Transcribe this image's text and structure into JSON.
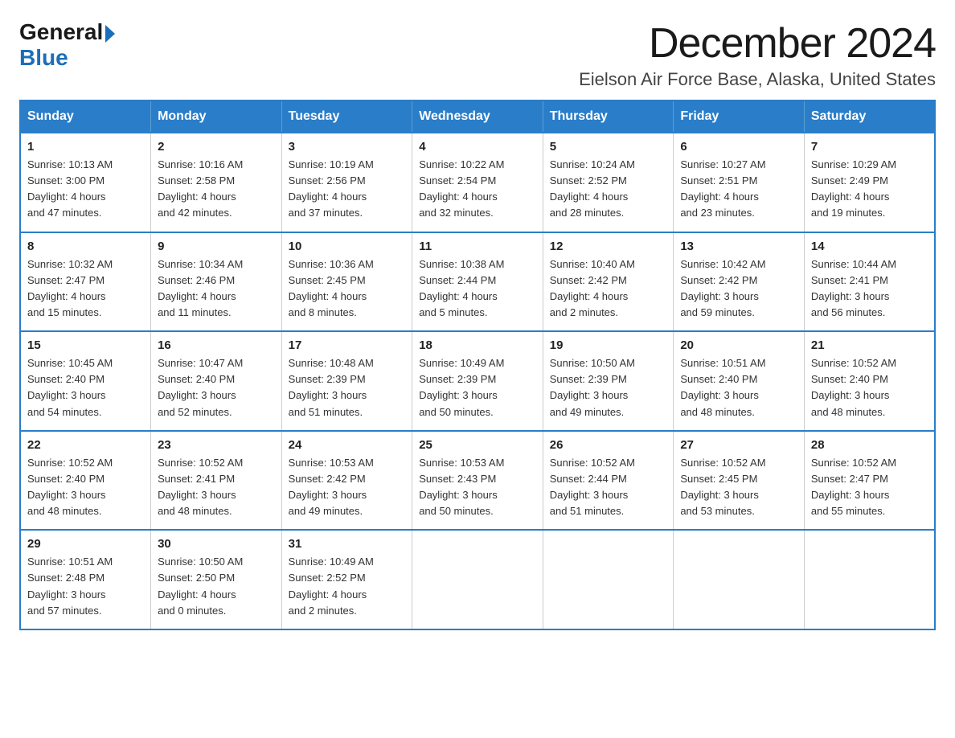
{
  "logo": {
    "general": "General",
    "triangle": "▶",
    "blue": "Blue"
  },
  "title": "December 2024",
  "subtitle": "Eielson Air Force Base, Alaska, United States",
  "days_of_week": [
    "Sunday",
    "Monday",
    "Tuesday",
    "Wednesday",
    "Thursday",
    "Friday",
    "Saturday"
  ],
  "weeks": [
    [
      {
        "day": "1",
        "info": "Sunrise: 10:13 AM\nSunset: 3:00 PM\nDaylight: 4 hours\nand 47 minutes."
      },
      {
        "day": "2",
        "info": "Sunrise: 10:16 AM\nSunset: 2:58 PM\nDaylight: 4 hours\nand 42 minutes."
      },
      {
        "day": "3",
        "info": "Sunrise: 10:19 AM\nSunset: 2:56 PM\nDaylight: 4 hours\nand 37 minutes."
      },
      {
        "day": "4",
        "info": "Sunrise: 10:22 AM\nSunset: 2:54 PM\nDaylight: 4 hours\nand 32 minutes."
      },
      {
        "day": "5",
        "info": "Sunrise: 10:24 AM\nSunset: 2:52 PM\nDaylight: 4 hours\nand 28 minutes."
      },
      {
        "day": "6",
        "info": "Sunrise: 10:27 AM\nSunset: 2:51 PM\nDaylight: 4 hours\nand 23 minutes."
      },
      {
        "day": "7",
        "info": "Sunrise: 10:29 AM\nSunset: 2:49 PM\nDaylight: 4 hours\nand 19 minutes."
      }
    ],
    [
      {
        "day": "8",
        "info": "Sunrise: 10:32 AM\nSunset: 2:47 PM\nDaylight: 4 hours\nand 15 minutes."
      },
      {
        "day": "9",
        "info": "Sunrise: 10:34 AM\nSunset: 2:46 PM\nDaylight: 4 hours\nand 11 minutes."
      },
      {
        "day": "10",
        "info": "Sunrise: 10:36 AM\nSunset: 2:45 PM\nDaylight: 4 hours\nand 8 minutes."
      },
      {
        "day": "11",
        "info": "Sunrise: 10:38 AM\nSunset: 2:44 PM\nDaylight: 4 hours\nand 5 minutes."
      },
      {
        "day": "12",
        "info": "Sunrise: 10:40 AM\nSunset: 2:42 PM\nDaylight: 4 hours\nand 2 minutes."
      },
      {
        "day": "13",
        "info": "Sunrise: 10:42 AM\nSunset: 2:42 PM\nDaylight: 3 hours\nand 59 minutes."
      },
      {
        "day": "14",
        "info": "Sunrise: 10:44 AM\nSunset: 2:41 PM\nDaylight: 3 hours\nand 56 minutes."
      }
    ],
    [
      {
        "day": "15",
        "info": "Sunrise: 10:45 AM\nSunset: 2:40 PM\nDaylight: 3 hours\nand 54 minutes."
      },
      {
        "day": "16",
        "info": "Sunrise: 10:47 AM\nSunset: 2:40 PM\nDaylight: 3 hours\nand 52 minutes."
      },
      {
        "day": "17",
        "info": "Sunrise: 10:48 AM\nSunset: 2:39 PM\nDaylight: 3 hours\nand 51 minutes."
      },
      {
        "day": "18",
        "info": "Sunrise: 10:49 AM\nSunset: 2:39 PM\nDaylight: 3 hours\nand 50 minutes."
      },
      {
        "day": "19",
        "info": "Sunrise: 10:50 AM\nSunset: 2:39 PM\nDaylight: 3 hours\nand 49 minutes."
      },
      {
        "day": "20",
        "info": "Sunrise: 10:51 AM\nSunset: 2:40 PM\nDaylight: 3 hours\nand 48 minutes."
      },
      {
        "day": "21",
        "info": "Sunrise: 10:52 AM\nSunset: 2:40 PM\nDaylight: 3 hours\nand 48 minutes."
      }
    ],
    [
      {
        "day": "22",
        "info": "Sunrise: 10:52 AM\nSunset: 2:40 PM\nDaylight: 3 hours\nand 48 minutes."
      },
      {
        "day": "23",
        "info": "Sunrise: 10:52 AM\nSunset: 2:41 PM\nDaylight: 3 hours\nand 48 minutes."
      },
      {
        "day": "24",
        "info": "Sunrise: 10:53 AM\nSunset: 2:42 PM\nDaylight: 3 hours\nand 49 minutes."
      },
      {
        "day": "25",
        "info": "Sunrise: 10:53 AM\nSunset: 2:43 PM\nDaylight: 3 hours\nand 50 minutes."
      },
      {
        "day": "26",
        "info": "Sunrise: 10:52 AM\nSunset: 2:44 PM\nDaylight: 3 hours\nand 51 minutes."
      },
      {
        "day": "27",
        "info": "Sunrise: 10:52 AM\nSunset: 2:45 PM\nDaylight: 3 hours\nand 53 minutes."
      },
      {
        "day": "28",
        "info": "Sunrise: 10:52 AM\nSunset: 2:47 PM\nDaylight: 3 hours\nand 55 minutes."
      }
    ],
    [
      {
        "day": "29",
        "info": "Sunrise: 10:51 AM\nSunset: 2:48 PM\nDaylight: 3 hours\nand 57 minutes."
      },
      {
        "day": "30",
        "info": "Sunrise: 10:50 AM\nSunset: 2:50 PM\nDaylight: 4 hours\nand 0 minutes."
      },
      {
        "day": "31",
        "info": "Sunrise: 10:49 AM\nSunset: 2:52 PM\nDaylight: 4 hours\nand 2 minutes."
      },
      null,
      null,
      null,
      null
    ]
  ]
}
